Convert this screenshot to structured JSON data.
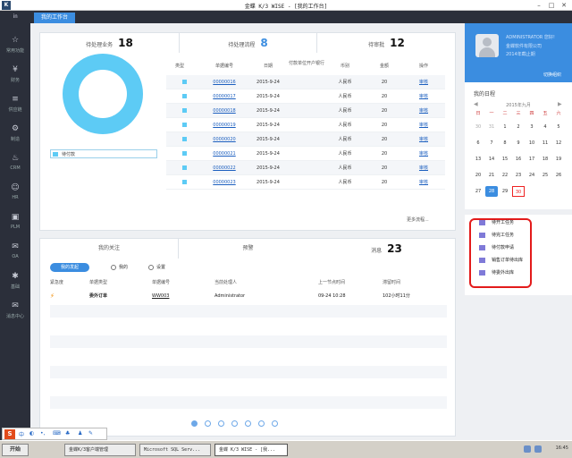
{
  "window": {
    "title": "金蝶 K/3 WISE - [我的工作台]"
  },
  "tabs": {
    "home": "㏌",
    "active": "我的工作台"
  },
  "sidebar": {
    "items": [
      {
        "label": "常用功能",
        "icon": "star-icon"
      },
      {
        "label": "财务",
        "icon": "money-icon"
      },
      {
        "label": "供应链",
        "icon": "stack-icon"
      },
      {
        "label": "制造",
        "icon": "gear-icon"
      },
      {
        "label": "CRM",
        "icon": "handshake-icon"
      },
      {
        "label": "HR",
        "icon": "people-icon"
      },
      {
        "label": "PLM",
        "icon": "cube-icon"
      },
      {
        "label": "OA",
        "icon": "chat-icon"
      },
      {
        "label": "基础",
        "icon": "settings-icon"
      },
      {
        "label": "消息中心",
        "icon": "mail-icon"
      }
    ]
  },
  "top_panel": {
    "tabs": [
      {
        "label": "待处理业务",
        "count": "18"
      },
      {
        "label": "待处理流程",
        "count": "8"
      },
      {
        "label": "待审批",
        "count": "12"
      }
    ],
    "legend": "待付款",
    "columns": [
      "类型",
      "单据编号",
      "日期",
      "付款单位开户银行",
      "币别",
      "金额",
      "操作"
    ],
    "rows": [
      {
        "no": "00000016",
        "date": "2015-9-24",
        "currency": "人民币",
        "amount": "20",
        "action": "审核"
      },
      {
        "no": "00000017",
        "date": "2015-9-24",
        "currency": "人民币",
        "amount": "20",
        "action": "审核"
      },
      {
        "no": "00000018",
        "date": "2015-9-24",
        "currency": "人民币",
        "amount": "20",
        "action": "审核"
      },
      {
        "no": "00000019",
        "date": "2015-9-24",
        "currency": "人民币",
        "amount": "20",
        "action": "审核"
      },
      {
        "no": "00000020",
        "date": "2015-9-24",
        "currency": "人民币",
        "amount": "20",
        "action": "审核"
      },
      {
        "no": "00000021",
        "date": "2015-9-24",
        "currency": "人民币",
        "amount": "20",
        "action": "审核"
      },
      {
        "no": "00000022",
        "date": "2015-9-24",
        "currency": "人民币",
        "amount": "20",
        "action": "审核"
      },
      {
        "no": "00000023",
        "date": "2015-9-24",
        "currency": "人民币",
        "amount": "20",
        "action": "审核"
      }
    ],
    "more": "更多流程..."
  },
  "bottom_panel": {
    "tabs": [
      {
        "label": "我的关注",
        "count": ""
      },
      {
        "label": "预警",
        "count": ""
      },
      {
        "label": "消息",
        "count": "23"
      }
    ],
    "filters": [
      "我的发起",
      "我的",
      "设置"
    ],
    "columns": [
      "紧急度",
      "单据类型",
      "单据编号",
      "当前处理人",
      "上一节点时间",
      "滞留时间"
    ],
    "rows": [
      {
        "type": "委外订单",
        "no": "WW003",
        "handler": "Administrator",
        "time": "09-24 10:28",
        "stay": "102小时11分"
      }
    ]
  },
  "user": {
    "name": "ADMINISTRATOR 您好!",
    "company": "金蝶软件有限公司",
    "since": "2014年截止期",
    "switch": "切换组织"
  },
  "calendar": {
    "title": "我的日程",
    "month": "2015年九月",
    "weekdays": [
      "日",
      "一",
      "二",
      "三",
      "四",
      "五",
      "六"
    ],
    "weeks": [
      [
        "30",
        "31",
        "1",
        "2",
        "3",
        "4",
        "5"
      ],
      [
        "6",
        "7",
        "8",
        "9",
        "10",
        "11",
        "12"
      ],
      [
        "13",
        "14",
        "15",
        "16",
        "17",
        "18",
        "19"
      ],
      [
        "20",
        "21",
        "22",
        "23",
        "24",
        "25",
        "26"
      ],
      [
        "27",
        "28",
        "29",
        "30",
        "",
        "",
        ""
      ]
    ],
    "today": "28",
    "highlight": "30"
  },
  "tasks": {
    "items": [
      "待开工任务",
      "待完工任务",
      "待付款申请",
      "销售订单待出库",
      "待委外出库"
    ]
  },
  "taskbar": {
    "start": "开始",
    "buttons": [
      "金蝶K/3客户端管理",
      "Microsoft SQL Serv...",
      "金蝶 K/3 WISE - [我..."
    ],
    "clock": "16:45"
  },
  "colors": {
    "accent": "#3b8de0",
    "donut": "#5dcbf5",
    "sidebar": "#2b2f3a",
    "highlight_red": "#e31b1b"
  }
}
